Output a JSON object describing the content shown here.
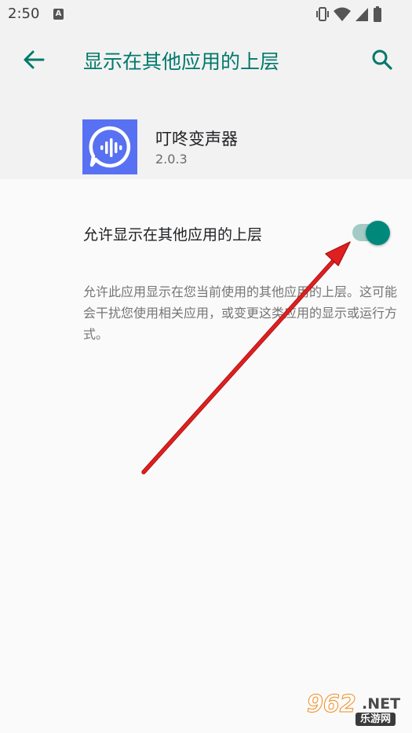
{
  "status_bar": {
    "time": "2:50",
    "notification_letter": "A",
    "icons": [
      "vibrate-icon",
      "wifi-icon",
      "signal-icon",
      "battery-icon"
    ]
  },
  "app_bar": {
    "title": "显示在其他应用的上层",
    "back_icon": "arrow-back-icon",
    "search_icon": "search-icon",
    "accent_color": "#00796b"
  },
  "app_info": {
    "name": "叮咚变声器",
    "version": "2.0.3",
    "icon_color": "#5871f2"
  },
  "setting": {
    "label": "允许显示在其他应用的上层",
    "enabled": true,
    "description": "允许此应用显示在您当前使用的其他应用的上层。这可能会干扰您使用相关应用，或变更这类应用的显示或运行方式。"
  },
  "annotation": {
    "arrow_color": "#e02020"
  },
  "watermark": {
    "number": "962",
    "domain": ".NET",
    "site": "乐游网"
  }
}
